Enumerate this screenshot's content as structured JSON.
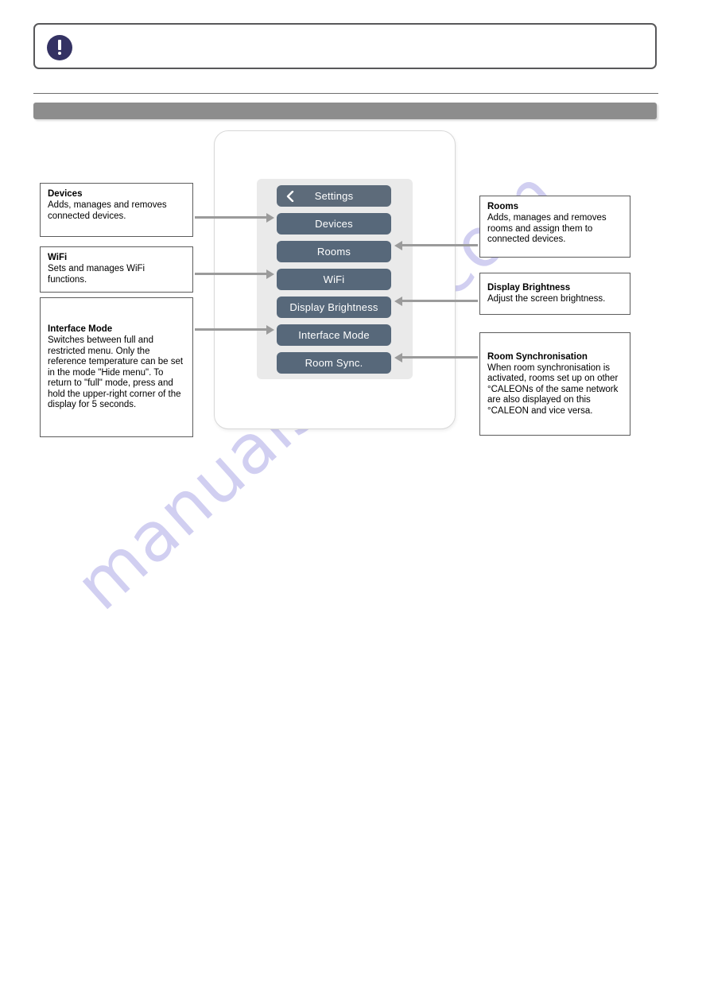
{
  "page": {
    "watermark": "manualshive.com",
    "notice": {
      "icon": "exclamation-icon",
      "text": ""
    },
    "section_bar_label": ""
  },
  "device": {
    "screen_title": "Settings",
    "back_icon": "chevron-left-icon",
    "menu_items": [
      {
        "label": "Devices"
      },
      {
        "label": "Rooms"
      },
      {
        "label": "WiFi"
      },
      {
        "label": "Display Brightness"
      },
      {
        "label": "Interface Mode"
      },
      {
        "label": "Room Sync."
      }
    ]
  },
  "callouts": {
    "left": [
      {
        "title": "Devices",
        "body": "Adds, manages and removes connected devices."
      },
      {
        "title": "WiFi",
        "body": "Sets and manages WiFi functions."
      },
      {
        "title": "Interface Mode",
        "body": "Switches between full and restricted menu. Only the reference temperature can be set in the mode \"Hide menu\". To return to \"full\" mode, press and hold the upper-right corner of the display for 5 seconds."
      }
    ],
    "right": [
      {
        "title": "Rooms",
        "body": "Adds, manages and removes rooms and assign them to connected devices."
      },
      {
        "title": "Display Brightness",
        "body": "Adjust the screen brightness."
      },
      {
        "title": "Room Synchronisation",
        "body": "When room synchronisation is activated, rooms set up on other °CALEONs of the same network are also displayed on this °CALEON and vice versa."
      }
    ]
  },
  "colors": {
    "button": "#57687a",
    "screen_bg": "#eaeaea",
    "arrow": "#9b9b9b",
    "notice_icon": "#343263",
    "section_bar": "#8d8d8d",
    "watermark": "#c9c7ef"
  }
}
